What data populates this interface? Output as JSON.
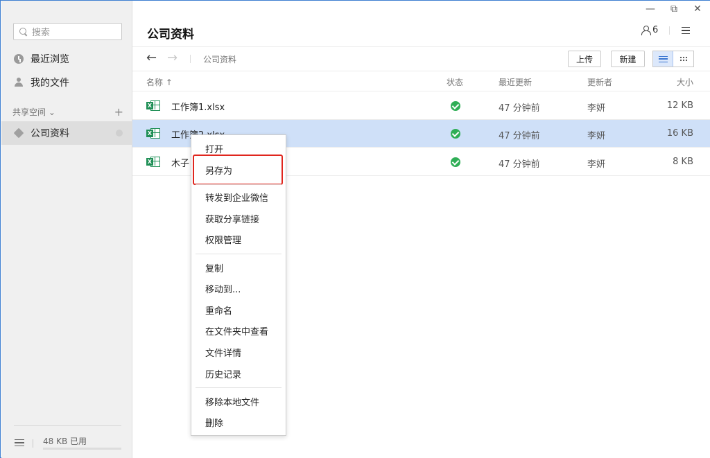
{
  "window": {
    "controls": {
      "minimize": "—",
      "restore": "⧉",
      "close": "✕"
    }
  },
  "sidebar": {
    "search_placeholder": "搜索",
    "items": [
      {
        "label": "最近浏览",
        "icon": "clock-icon"
      },
      {
        "label": "我的文件",
        "icon": "user-icon"
      }
    ],
    "section_title": "共享空间",
    "section_chevron": "⌄",
    "section_add": "+",
    "spaces": [
      {
        "label": "公司资料",
        "icon": "cube-icon",
        "active": true
      }
    ],
    "storage_usage": "48 KB 已用"
  },
  "header": {
    "title": "公司资料",
    "member_count": "6"
  },
  "toolbar": {
    "back": "←",
    "forward": "→",
    "breadcrumb": "公司资料",
    "upload_label": "上传",
    "new_label": "新建",
    "view_mode": "list"
  },
  "table": {
    "columns": {
      "name": "名称 ↑",
      "status": "状态",
      "updated": "最近更新",
      "updater": "更新者",
      "size": "大小"
    },
    "rows": [
      {
        "name": "工作簿1.xlsx",
        "status": "synced",
        "updated": "47 分钟前",
        "updater": "李妍",
        "size": "12 KB",
        "selected": false
      },
      {
        "name": "工作簿2.xlsx",
        "status": "synced",
        "updated": "47 分钟前",
        "updater": "李妍",
        "size": "16 KB",
        "selected": true
      },
      {
        "name": "木子",
        "status": "synced",
        "updated": "47 分钟前",
        "updater": "李妍",
        "size": "8 KB",
        "selected": false
      }
    ],
    "file_badge": "X"
  },
  "context_menu": {
    "items": [
      "打开",
      "另存为",
      "转发到企业微信",
      "获取分享链接",
      "权限管理",
      "复制",
      "移动到...",
      "重命名",
      "在文件夹中查看",
      "文件详情",
      "历史记录",
      "移除本地文件",
      "删除"
    ],
    "highlighted": "另存为"
  },
  "colors": {
    "accent": "#3a75d0",
    "selected_row": "#cfe0f8",
    "status_ok": "#2fae56",
    "excel_green": "#1f8f56",
    "highlight_border": "#e0261e"
  }
}
